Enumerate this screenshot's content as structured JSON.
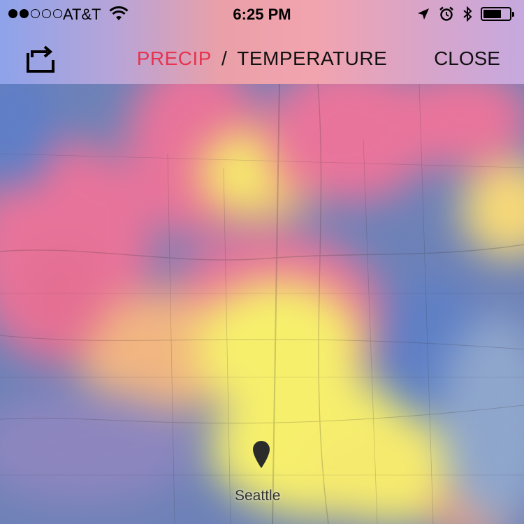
{
  "status_bar": {
    "carrier": "AT&T",
    "time": "6:25 PM",
    "signal_bars": 2,
    "signal_total": 5,
    "battery_level": 0.7,
    "icons": [
      "wifi-icon",
      "location-arrow-icon",
      "alarm-icon",
      "bluetooth-icon",
      "battery-icon"
    ]
  },
  "nav": {
    "share_icon": "share-icon",
    "tab_precip": "PRECIP",
    "separator": "/",
    "tab_temperature": "TEMPERATURE",
    "close_label": "CLOSE",
    "active_tab": "precip"
  },
  "map": {
    "pin_label": "Seattle",
    "legend_colors": [
      "#5f7ec6",
      "#e76f96",
      "#f7f26b"
    ]
  },
  "colors": {
    "precip_active": "#e6334f",
    "text": "#111111"
  }
}
